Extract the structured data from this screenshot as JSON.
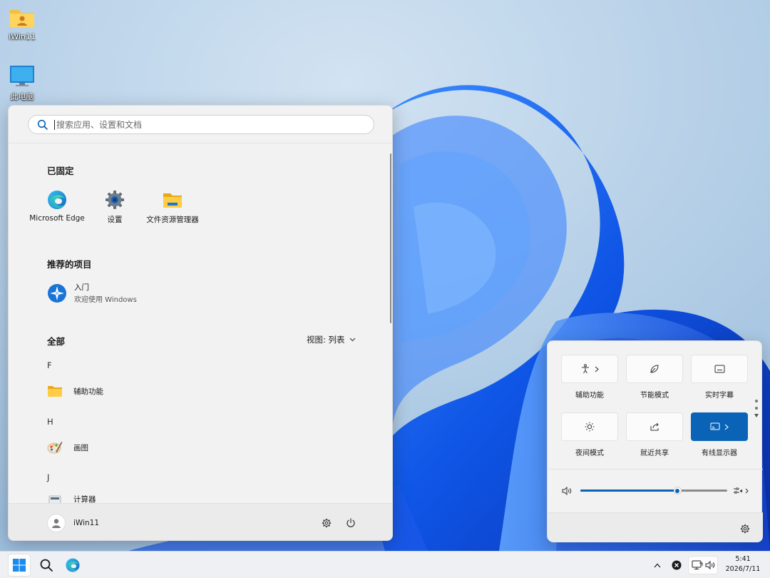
{
  "desktop": {
    "icons": [
      {
        "name": "user-folder",
        "label": "iWin11"
      },
      {
        "name": "this-pc",
        "label": "此电脑"
      }
    ]
  },
  "start_menu": {
    "search_placeholder": "搜索应用、设置和文档",
    "pinned_title": "已固定",
    "pinned": [
      {
        "label": "Microsoft Edge",
        "icon": "edge-icon"
      },
      {
        "label": "设置",
        "icon": "settings-gear-icon"
      },
      {
        "label": "文件资源管理器",
        "icon": "file-explorer-icon"
      }
    ],
    "recommended_title": "推荐的项目",
    "recommended": [
      {
        "title": "入门",
        "subtitle": "欢迎使用 Windows",
        "icon": "get-started-icon"
      }
    ],
    "all_title": "全部",
    "view_label": "视图: 列表",
    "all_apps": [
      {
        "letter": "F",
        "label": "辅助功能",
        "icon": "folder-icon"
      },
      {
        "letter": "H",
        "label": "画图",
        "icon": "paint-icon"
      },
      {
        "letter": "J",
        "label": "计算器",
        "icon": "calculator-icon"
      }
    ],
    "user_name": "iWin11"
  },
  "quick_settings": {
    "tiles": [
      {
        "label": "辅助功能",
        "icon": "accessibility-icon",
        "has_chevron": true,
        "active": false
      },
      {
        "label": "节能模式",
        "icon": "leaf-icon",
        "has_chevron": false,
        "active": false
      },
      {
        "label": "实时字幕",
        "icon": "captions-icon",
        "has_chevron": false,
        "active": false
      },
      {
        "label": "夜间模式",
        "icon": "brightness-icon",
        "has_chevron": false,
        "active": false
      },
      {
        "label": "就近共享",
        "icon": "share-icon",
        "has_chevron": false,
        "active": false
      },
      {
        "label": "有线显示器",
        "icon": "cast-icon",
        "has_chevron": true,
        "active": true
      }
    ],
    "volume_percent": 66,
    "accent_color": "#0a63b6"
  },
  "taskbar": {
    "time": "5:41",
    "date": "2026/7/11"
  }
}
